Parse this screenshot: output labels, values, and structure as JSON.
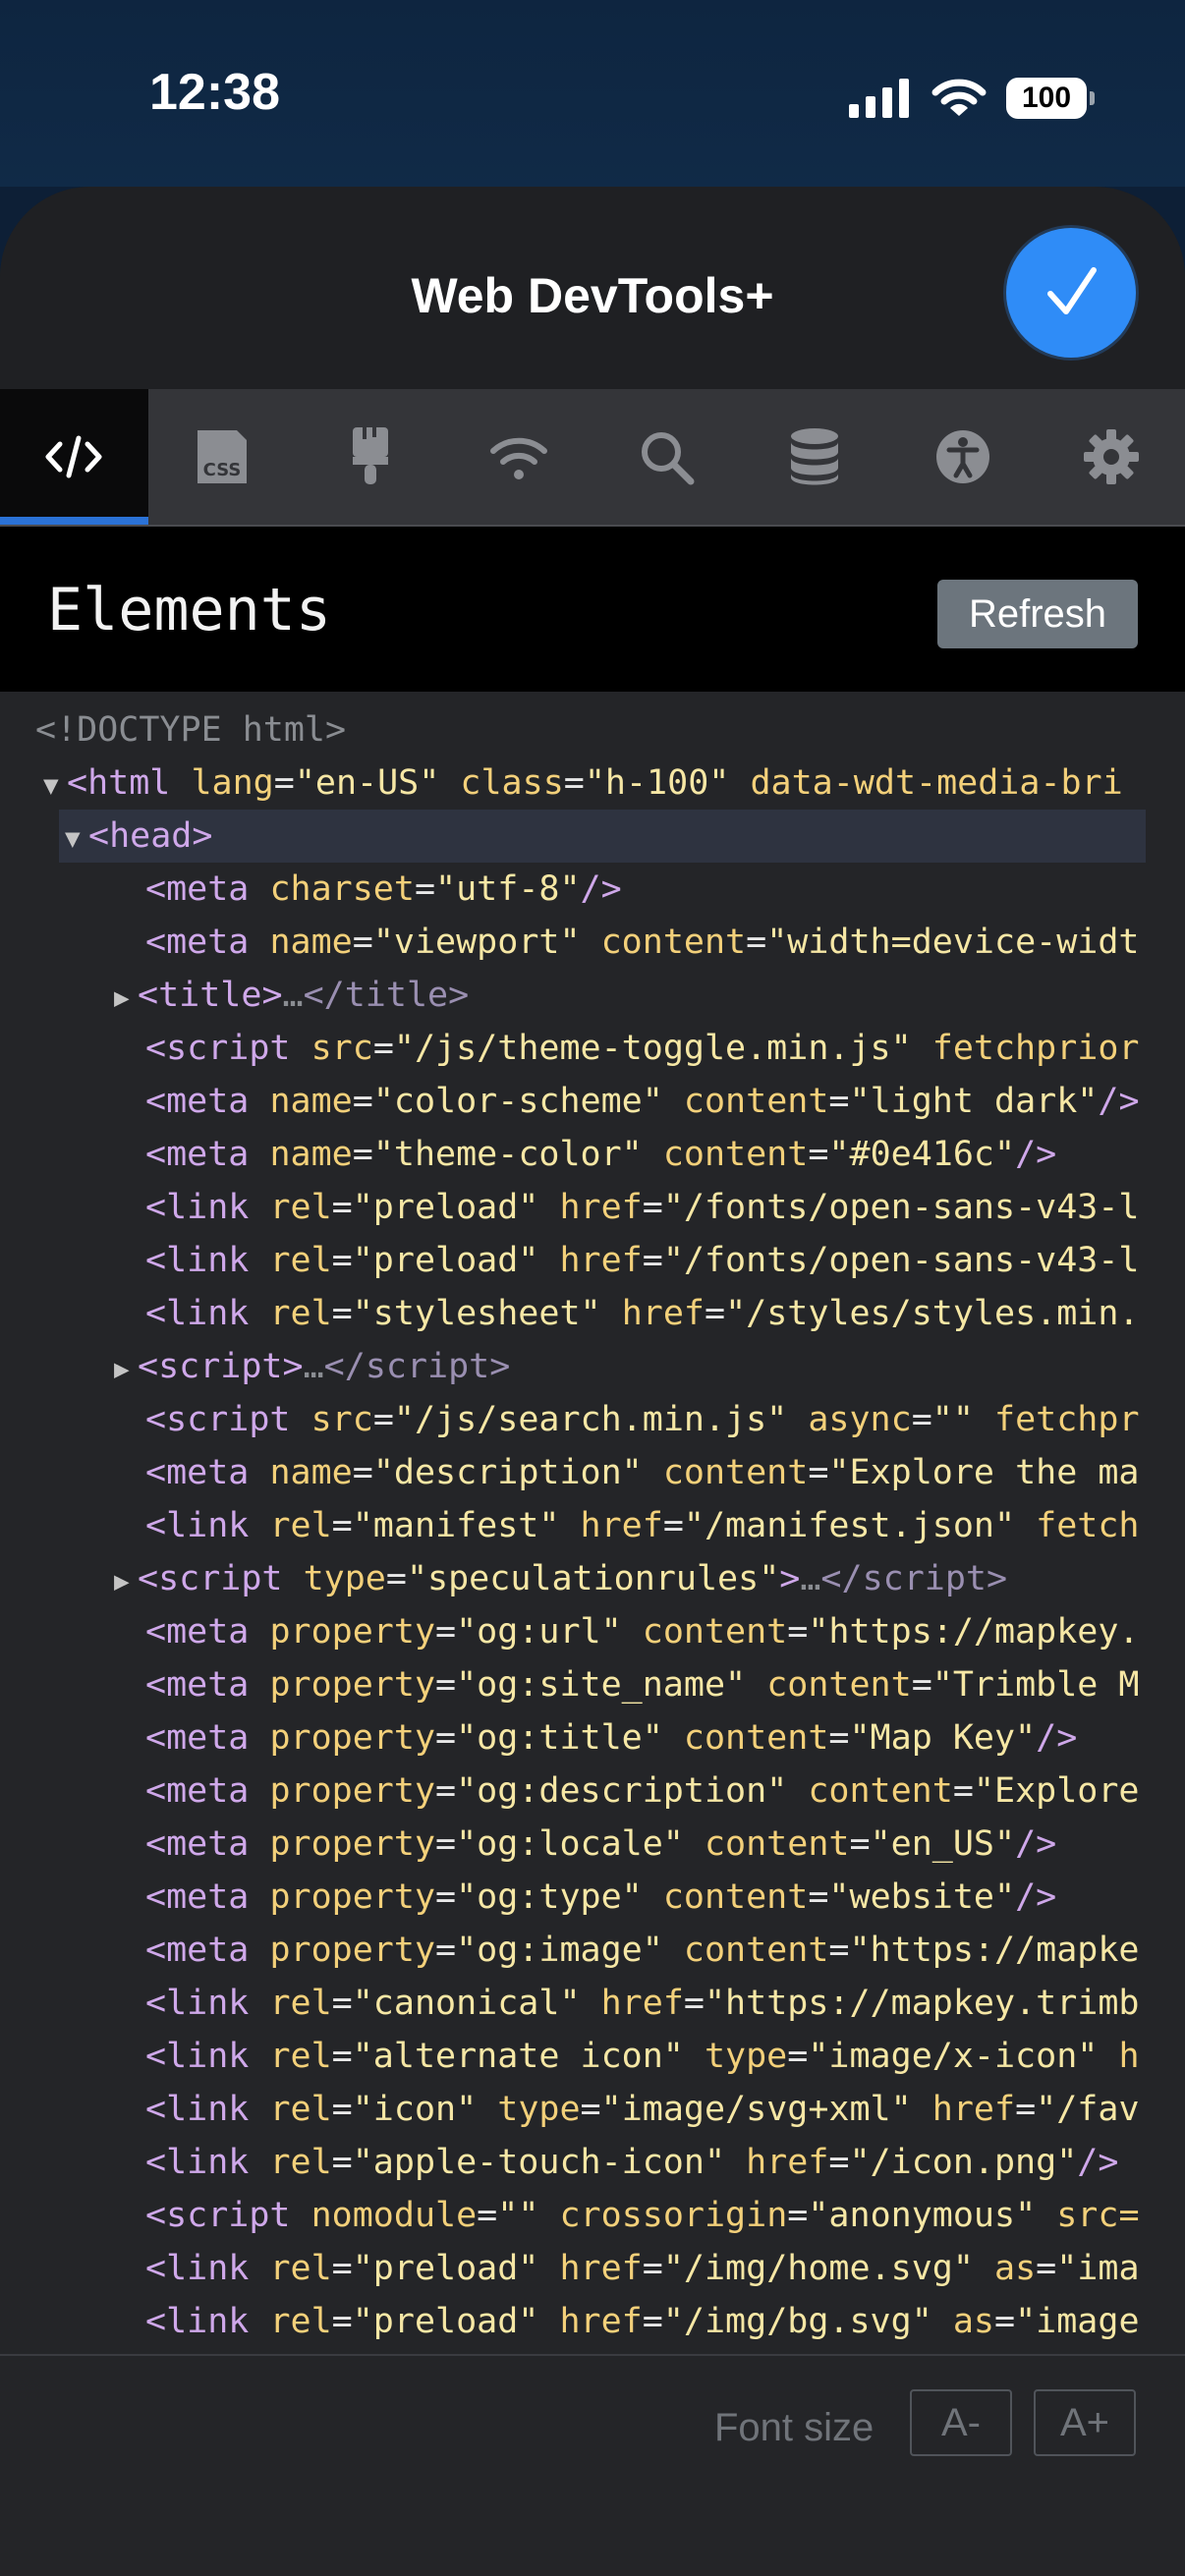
{
  "status_bar": {
    "time": "12:38",
    "battery": "100"
  },
  "header": {
    "title": "Web DevTools+"
  },
  "tabs": [
    {
      "icon": "code-icon",
      "active": true
    },
    {
      "icon": "css-icon",
      "active": false
    },
    {
      "icon": "brush-icon",
      "active": false
    },
    {
      "icon": "wifi-icon",
      "active": false
    },
    {
      "icon": "search-icon",
      "active": false
    },
    {
      "icon": "database-icon",
      "active": false
    },
    {
      "icon": "accessibility-icon",
      "active": false
    },
    {
      "icon": "gear-icon",
      "active": false
    }
  ],
  "panel": {
    "title": "Elements",
    "refresh_label": "Refresh"
  },
  "footer": {
    "font_size_label": "Font size",
    "decrease_label": "A-",
    "increase_label": "A+"
  },
  "dom_lines": [
    {
      "indent": 0,
      "arrow": "",
      "text": "<!DOCTYPE html>",
      "kind": "doctype"
    },
    {
      "indent": 0,
      "arrow": "▼",
      "tag": "html",
      "attrs": [
        [
          "lang",
          "en-US"
        ],
        [
          "class",
          "h-100"
        ],
        [
          "data-wdt-media-bri",
          null
        ]
      ]
    },
    {
      "indent": 1,
      "arrow": "▼",
      "tag": "head",
      "selected": true
    },
    {
      "indent": 2,
      "tag": "meta",
      "attrs": [
        [
          "charset",
          "utf-8"
        ]
      ],
      "selfclose": true
    },
    {
      "indent": 2,
      "tag": "meta",
      "attrs": [
        [
          "name",
          "viewport"
        ],
        [
          "content",
          "width=device-widt",
          null
        ]
      ]
    },
    {
      "indent": 2,
      "arrow": "▶",
      "tag": "title",
      "collapsed": true
    },
    {
      "indent": 2,
      "tag": "script",
      "attrs": [
        [
          "src",
          "/js/theme-toggle.min.js"
        ],
        [
          "fetchprior",
          null
        ]
      ]
    },
    {
      "indent": 2,
      "tag": "meta",
      "attrs": [
        [
          "name",
          "color-scheme"
        ],
        [
          "content",
          "light dark"
        ]
      ],
      "selfclose": true
    },
    {
      "indent": 2,
      "tag": "meta",
      "attrs": [
        [
          "name",
          "theme-color"
        ],
        [
          "content",
          "#0e416c"
        ]
      ],
      "selfclose": true
    },
    {
      "indent": 2,
      "tag": "link",
      "attrs": [
        [
          "rel",
          "preload"
        ],
        [
          "href",
          "/fonts/open-sans-v43-l",
          null
        ]
      ]
    },
    {
      "indent": 2,
      "tag": "link",
      "attrs": [
        [
          "rel",
          "preload"
        ],
        [
          "href",
          "/fonts/open-sans-v43-l",
          null
        ]
      ]
    },
    {
      "indent": 2,
      "tag": "link",
      "attrs": [
        [
          "rel",
          "stylesheet"
        ],
        [
          "href",
          "/styles/styles.min.",
          null
        ]
      ]
    },
    {
      "indent": 2,
      "arrow": "▶",
      "tag": "script",
      "collapsed": true
    },
    {
      "indent": 2,
      "tag": "script",
      "attrs": [
        [
          "src",
          "/js/search.min.js"
        ],
        [
          "async",
          ""
        ],
        [
          "fetchpr",
          null
        ]
      ]
    },
    {
      "indent": 2,
      "tag": "meta",
      "attrs": [
        [
          "name",
          "description"
        ],
        [
          "content",
          "Explore the ma",
          null
        ]
      ]
    },
    {
      "indent": 2,
      "tag": "link",
      "attrs": [
        [
          "rel",
          "manifest"
        ],
        [
          "href",
          "/manifest.json"
        ],
        [
          "fetch",
          null
        ]
      ]
    },
    {
      "indent": 2,
      "arrow": "▶",
      "tag": "script",
      "attrs": [
        [
          "type",
          "speculationrules"
        ]
      ],
      "collapsed": true
    },
    {
      "indent": 2,
      "tag": "meta",
      "attrs": [
        [
          "property",
          "og:url"
        ],
        [
          "content",
          "https://mapkey.",
          null
        ]
      ]
    },
    {
      "indent": 2,
      "tag": "meta",
      "attrs": [
        [
          "property",
          "og:site_name"
        ],
        [
          "content",
          "Trimble M",
          null
        ]
      ]
    },
    {
      "indent": 2,
      "tag": "meta",
      "attrs": [
        [
          "property",
          "og:title"
        ],
        [
          "content",
          "Map Key"
        ]
      ],
      "selfclose": true
    },
    {
      "indent": 2,
      "tag": "meta",
      "attrs": [
        [
          "property",
          "og:description"
        ],
        [
          "content",
          "Explore",
          null
        ]
      ]
    },
    {
      "indent": 2,
      "tag": "meta",
      "attrs": [
        [
          "property",
          "og:locale"
        ],
        [
          "content",
          "en_US"
        ]
      ],
      "selfclose": true
    },
    {
      "indent": 2,
      "tag": "meta",
      "attrs": [
        [
          "property",
          "og:type"
        ],
        [
          "content",
          "website"
        ]
      ],
      "selfclose": true
    },
    {
      "indent": 2,
      "tag": "meta",
      "attrs": [
        [
          "property",
          "og:image"
        ],
        [
          "content",
          "https://mapke",
          null
        ]
      ]
    },
    {
      "indent": 2,
      "tag": "link",
      "attrs": [
        [
          "rel",
          "canonical"
        ],
        [
          "href",
          "https://mapkey.trimb",
          null
        ]
      ]
    },
    {
      "indent": 2,
      "tag": "link",
      "attrs": [
        [
          "rel",
          "alternate icon"
        ],
        [
          "type",
          "image/x-icon"
        ],
        [
          "h",
          null
        ]
      ]
    },
    {
      "indent": 2,
      "tag": "link",
      "attrs": [
        [
          "rel",
          "icon"
        ],
        [
          "type",
          "image/svg+xml"
        ],
        [
          "href",
          "/fav",
          null
        ]
      ]
    },
    {
      "indent": 2,
      "tag": "link",
      "attrs": [
        [
          "rel",
          "apple-touch-icon"
        ],
        [
          "href",
          "/icon.png"
        ]
      ],
      "selfclose": true
    },
    {
      "indent": 2,
      "tag": "script",
      "attrs": [
        [
          "nomodule",
          ""
        ],
        [
          "crossorigin",
          "anonymous"
        ],
        [
          "src=",
          null
        ]
      ]
    },
    {
      "indent": 2,
      "tag": "link",
      "attrs": [
        [
          "rel",
          "preload"
        ],
        [
          "href",
          "/img/home.svg"
        ],
        [
          "as",
          "ima",
          null
        ]
      ]
    },
    {
      "indent": 2,
      "tag": "link",
      "attrs": [
        [
          "rel",
          "preload"
        ],
        [
          "href",
          "/img/bg.svg"
        ],
        [
          "as",
          "image",
          null
        ]
      ]
    }
  ],
  "colors": {
    "accent": "#2f8cf7",
    "active_tab_underline": "#2b72d6",
    "tag": "#cfa8ea",
    "attr": "#f3d07a",
    "value": "#f6e7a5"
  }
}
